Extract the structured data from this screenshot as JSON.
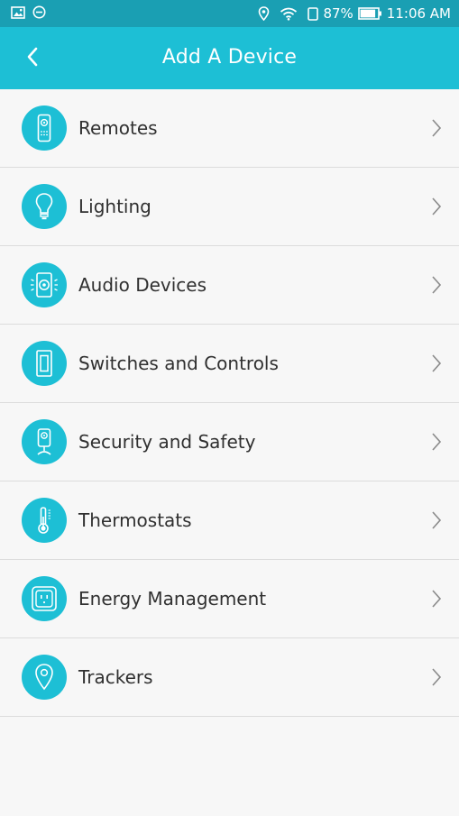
{
  "status_bar": {
    "battery": "87%",
    "time": "11:06 AM",
    "icons": [
      "image-icon",
      "minus-circle-icon",
      "location-icon",
      "wifi-icon",
      "tablet-icon",
      "battery-icon"
    ]
  },
  "header": {
    "title": "Add A Device",
    "back_icon": "back-chevron-icon"
  },
  "device_list": {
    "items": [
      {
        "label": "Remotes",
        "icon": "remote-icon"
      },
      {
        "label": "Lighting",
        "icon": "bulb-icon"
      },
      {
        "label": "Audio Devices",
        "icon": "speaker-icon"
      },
      {
        "label": "Switches and Controls",
        "icon": "switch-icon"
      },
      {
        "label": "Security and Safety",
        "icon": "camera-icon"
      },
      {
        "label": "Thermostats",
        "icon": "thermometer-icon"
      },
      {
        "label": "Energy Management",
        "icon": "outlet-icon"
      },
      {
        "label": "Trackers",
        "icon": "map-pin-icon"
      }
    ]
  },
  "colors": {
    "status_bar": "#1a9fb3",
    "header": "#1dbfd5",
    "accent": "#1dbfd5",
    "background": "#f7f7f7",
    "divider": "#dcdcdc",
    "text": "#303030"
  }
}
